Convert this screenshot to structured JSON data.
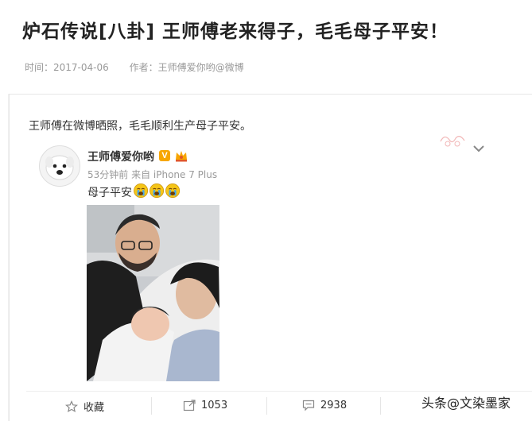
{
  "article": {
    "title": "炉石传说[八卦] 王师傅老来得子，毛毛母子平安！",
    "time_label": "时间：2017-04-06",
    "author_label": "作者：王师傅爱你哟@微博",
    "intro": "王师傅在微博晒照，毛毛顺利生产母子平安。"
  },
  "post": {
    "user_name": "王师傅爱你哟",
    "verified_badge": "V",
    "time_source": "53分钟前 来自 iPhone 7 Plus",
    "text": "母子平安",
    "emoji_icons": [
      "crying-face-icon",
      "crying-face-icon",
      "crying-face-icon"
    ]
  },
  "actions": {
    "favorite_label": "收藏",
    "repost_count": "1053",
    "comment_count": "2938"
  },
  "watermark": "头条@文染墨家",
  "colors": {
    "badge": "#f7a600",
    "emoji": "#f5c518",
    "muted_text": "#999999"
  }
}
